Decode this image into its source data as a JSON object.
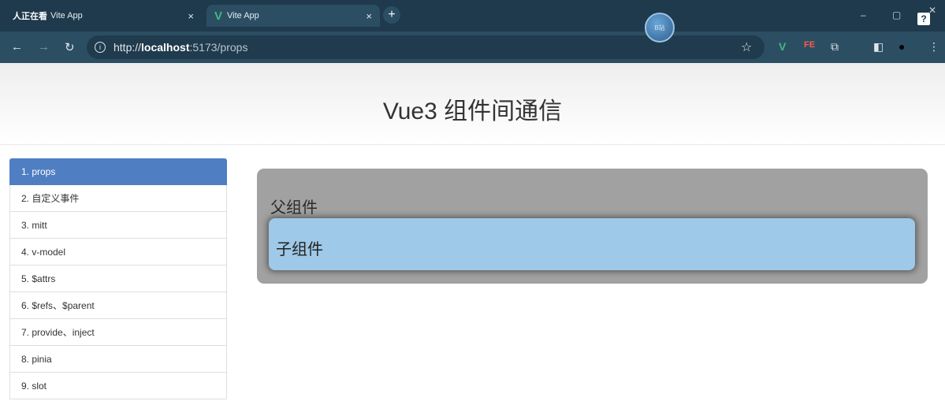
{
  "browser": {
    "tabs": [
      {
        "shared_label": "人正在看",
        "title": "Vite App",
        "close": "×"
      },
      {
        "title": "Vite App",
        "close": "×"
      }
    ],
    "new_tab": "+",
    "url": {
      "scheme": "http://",
      "host": "localhost",
      "rest": ":5173/props"
    },
    "window_controls": {
      "minimize": "–",
      "restore": "▢",
      "close": "✕",
      "help": "?"
    },
    "profile_bubble_text": "B站"
  },
  "page": {
    "title": "Vue3 组件间通信",
    "nav": [
      {
        "label": "1. props",
        "active": true
      },
      {
        "label": "2. 自定义事件"
      },
      {
        "label": "3. mitt"
      },
      {
        "label": "4. v-model"
      },
      {
        "label": "5. $attrs"
      },
      {
        "label": "6. $refs、$parent"
      },
      {
        "label": "7. provide、inject"
      },
      {
        "label": "8. pinia"
      },
      {
        "label": "9. slot"
      }
    ],
    "parent_label": "父组件",
    "child_label": "子组件"
  },
  "colors": {
    "chrome_dark": "#1e3a4c",
    "chrome_toolbar": "#2c4e63",
    "nav_active": "#4f7fc2",
    "parent_bg": "#a1a1a1",
    "child_bg": "#9ec9e8",
    "vue_green": "#41b883"
  }
}
